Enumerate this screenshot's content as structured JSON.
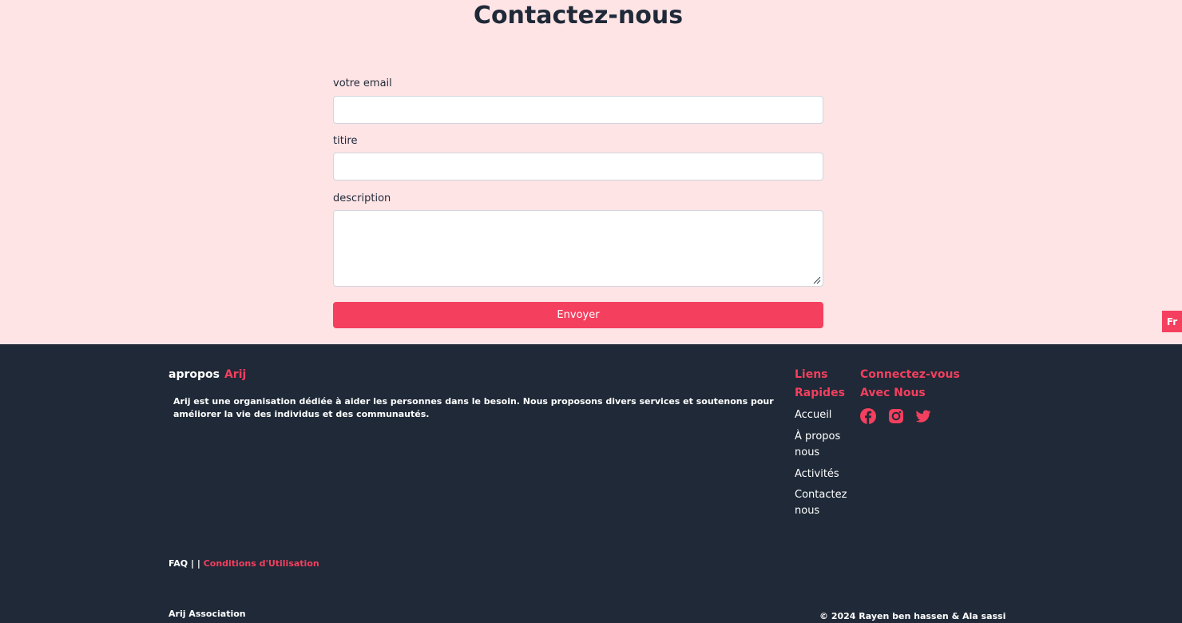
{
  "contact": {
    "title": "Contactez-nous",
    "email_label": "votre email",
    "email_value": "",
    "title_label": "titire",
    "title_value": "",
    "description_label": "description",
    "description_value": "",
    "submit_label": "Envoyer"
  },
  "language_badge": "Fr",
  "footer": {
    "about_prefix": "apropos",
    "about_brand": "Arij",
    "about_text": "Arij est une organisation dédiée à aider les personnes dans le besoin. Nous proposons divers services et soutenons pour améliorer la vie des individus et des communautés.",
    "quick_links_heading_line1": "Liens",
    "quick_links_heading_line2": "Rapides",
    "quick_links": [
      "Accueil",
      "À propos nous",
      "Activités",
      "Contactez nous"
    ],
    "connect_heading_line1": "Connectez-vous",
    "connect_heading_line2": "Avec Nous",
    "social_icons": [
      "facebook-icon",
      "instagram-icon",
      "twitter-icon"
    ],
    "faq_label": "FAQ",
    "separator": "| |",
    "terms_label": "Conditions d'Utilisation",
    "association_name": "Arij Association",
    "copyright": "© 2024 Rayen ben hassen & Ala sassi"
  },
  "colors": {
    "accent": "#f43f5e",
    "page_background": "#ffe4e6",
    "footer_background": "#1f2937"
  }
}
